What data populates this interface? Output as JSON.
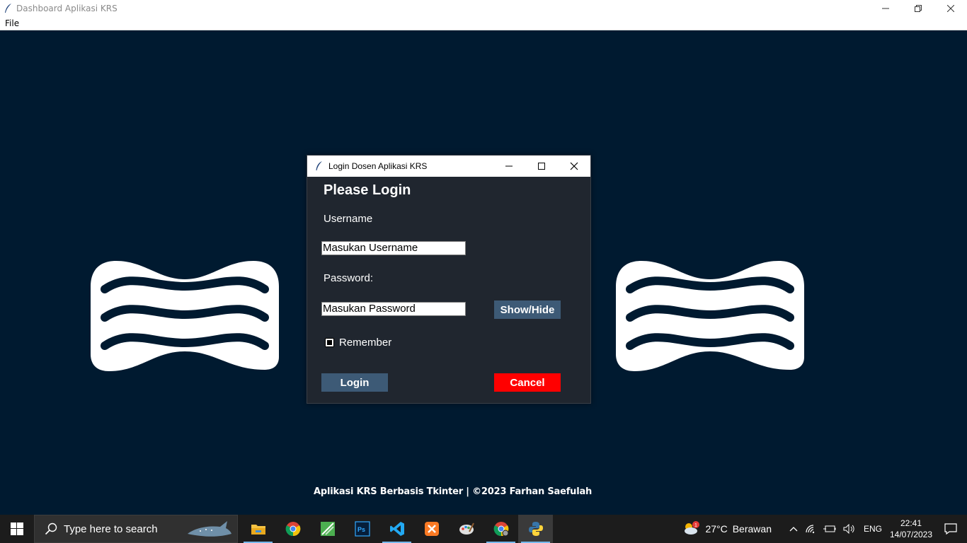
{
  "window": {
    "title": "Dashboard Aplikasi KRS",
    "menu": [
      "File"
    ]
  },
  "app": {
    "footer": "Aplikasi KRS Berbasis Tkinter | ©2023 Farhan Saefulah",
    "logo_icon": "wave-logo-icon",
    "background": "#001a30"
  },
  "dialog": {
    "title": "Login Dosen Aplikasi KRS",
    "heading": "Please Login",
    "username_label": "Username",
    "username_value": "Masukan Username",
    "password_label": "Password:",
    "password_value": "Masukan Password",
    "show_hide_label": "Show/Hide",
    "remember_label": "Remember",
    "remember_checked": true,
    "login_label": "Login",
    "cancel_label": "Cancel",
    "colors": {
      "background": "#20262f",
      "button": "#3d5a76",
      "cancel": "#ff0000"
    }
  },
  "taskbar": {
    "search_placeholder": "Type here to search",
    "apps": [
      "file-explorer-icon",
      "chrome-icon",
      "inkscape-icon",
      "photoshop-icon",
      "vscode-icon",
      "xampp-icon",
      "paint-icon",
      "chrome-profile-icon",
      "python-icon"
    ],
    "weather_temp": "27°C",
    "weather_condition": "Berawan",
    "weather_badge": "1",
    "language": "ENG",
    "time": "22:41",
    "date": "14/07/2023"
  }
}
